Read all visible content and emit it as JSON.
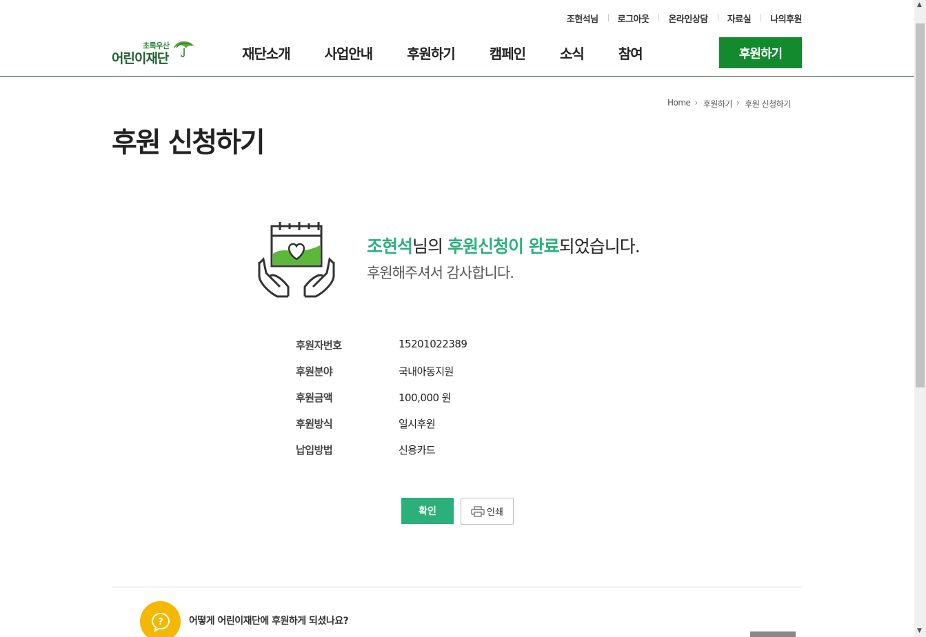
{
  "utility": {
    "user": "조현석님",
    "logout": "로그아웃",
    "consult": "온라인상담",
    "archive": "자료실",
    "my_donation": "나의후원"
  },
  "logo": {
    "small": "초록우산",
    "big": "어린이재단"
  },
  "gnb": [
    "재단소개",
    "사업안내",
    "후원하기",
    "캠페인",
    "소식",
    "참여"
  ],
  "header": {
    "donate_label": "후원하기"
  },
  "breadcrumb": [
    "Home",
    "후원하기",
    "후원 신청하기"
  ],
  "page_title": "후원 신청하기",
  "message": {
    "name": "조현석",
    "mid1": "님의 ",
    "highlight": "후원신청이 완료",
    "tail": "되었습니다.",
    "thanks": "후원해주셔서 감사합니다."
  },
  "info": [
    {
      "key": "후원자번호",
      "value": "15201022389"
    },
    {
      "key": "후원분야",
      "value": "국내아동지원"
    },
    {
      "key": "후원금액",
      "value": "100,000 원"
    },
    {
      "key": "후원방식",
      "value": "일시후원"
    },
    {
      "key": "납입방법",
      "value": "신용카드"
    }
  ],
  "buttons": {
    "ok": "확인",
    "print": "인쇄"
  },
  "survey": {
    "question": "어떻게 어린이재단에 후원하게 되셨나요?"
  },
  "colors": {
    "brand_green": "#138a2e",
    "accent": "#2bb07a",
    "survey_icon": "#f5b800"
  }
}
